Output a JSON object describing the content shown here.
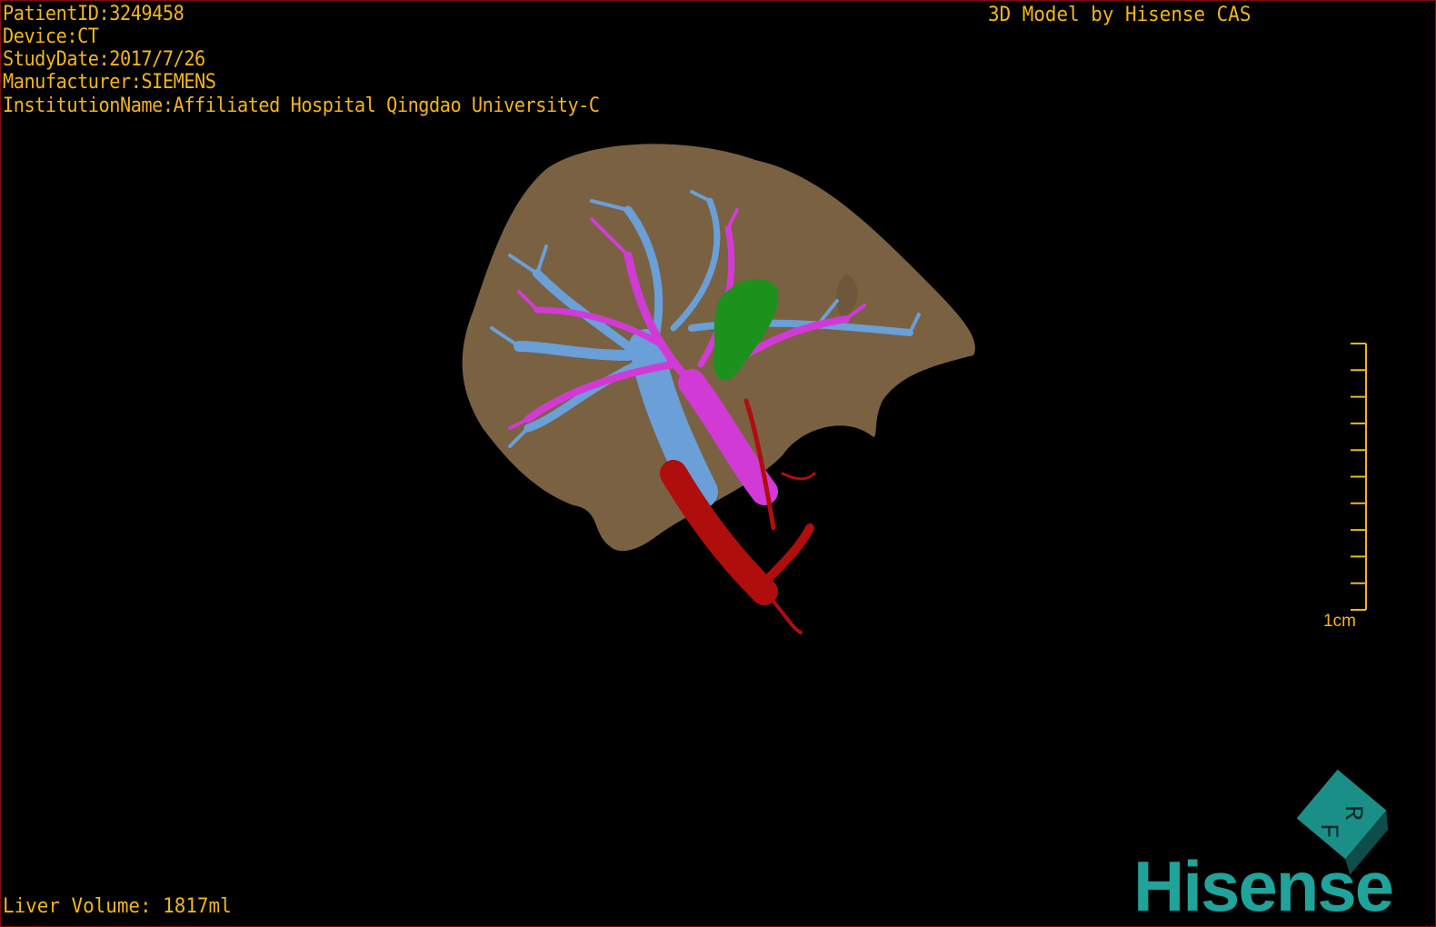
{
  "overlay": {
    "patient_id": "PatientID:3249458",
    "device": "Device:CT",
    "study_date": "StudyDate:2017/7/26",
    "manufacturer": "Manufacturer:SIEMENS",
    "institution": "InstitutionName:Affiliated Hospital Qingdao University-C",
    "brand_title": "3D Model by Hisense CAS",
    "liver_volume": "Liver Volume: 1817ml"
  },
  "scale_bar": {
    "label": "1cm",
    "ticks": 11
  },
  "orientation_cube": {
    "faces": [
      "R",
      "F"
    ]
  },
  "logo": {
    "text": "Hisense"
  },
  "colors": {
    "overlay_text": "#f2b51c",
    "liver": "#8a6e4b",
    "hepatic_vein": "#6a9fd8",
    "portal_vein": "#d23ad6",
    "artery": "#b00d0d",
    "gallbladder": "#1f9a1f",
    "brand": "#1fa39a"
  }
}
